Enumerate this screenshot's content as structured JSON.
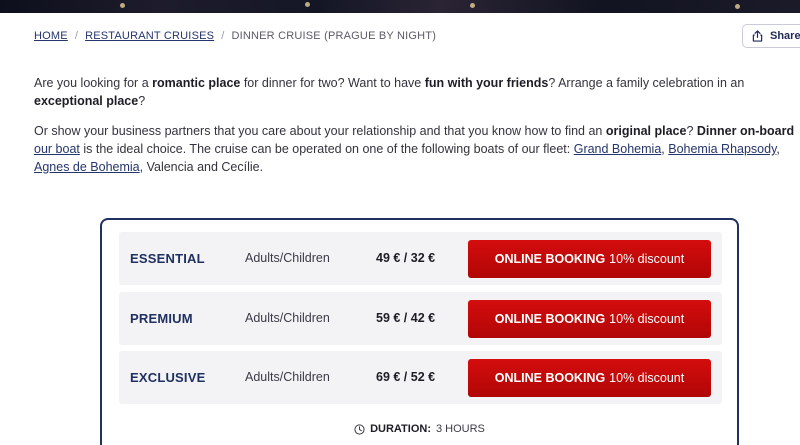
{
  "breadcrumb": {
    "home": "HOME",
    "section": "RESTAURANT CRUISES",
    "current": "DINNER CRUISE (PRAGUE BY NIGHT)",
    "separator": "/"
  },
  "share": {
    "label": "Share",
    "icon": "share-icon"
  },
  "intro": {
    "p1": {
      "t1": "Are you looking for a ",
      "b1": "romantic place",
      "t2": " for dinner for two? Want to have ",
      "b2": "fun with your friends",
      "t3": "? Arrange a family celebration in an ",
      "b3": "exceptional place",
      "t4": "?"
    },
    "p2": {
      "t1": "Or show your business partners that you care about your relationship and that you know how to find an ",
      "b1": "original place",
      "t2": "? ",
      "b2": "Dinner on-board",
      "t3": " ",
      "link1": "our boat",
      "t4": " is the ideal choice. The cruise can be operated on one of the following boats of our fleet: ",
      "link2": "Grand Bohemia",
      "t5": ", ",
      "link3": "Bohemia Rhapsody",
      "t6": ", ",
      "link4": "Agnes de Bohemia",
      "t7": ", Valencia and Cecílie."
    }
  },
  "pricing": {
    "rows": [
      {
        "tier": "ESSENTIAL",
        "who": "Adults/Children",
        "price": "49 € / 32 €",
        "cta_bold": "ONLINE BOOKING",
        "cta_rest": "10% discount"
      },
      {
        "tier": "PREMIUM",
        "who": "Adults/Children",
        "price": "59 € / 42 €",
        "cta_bold": "ONLINE BOOKING",
        "cta_rest": "10% discount"
      },
      {
        "tier": "EXCLUSIVE",
        "who": "Adults/Children",
        "price": "69 € / 52 €",
        "cta_bold": "ONLINE BOOKING",
        "cta_rest": "10% discount"
      }
    ],
    "duration_label": "DURATION:",
    "duration_value": "3 HOURS",
    "duration_icon": "clock-icon"
  },
  "colors": {
    "brand_navy": "#1f3061",
    "cta_red": "#c40909",
    "row_bg": "#f3f3f5"
  }
}
